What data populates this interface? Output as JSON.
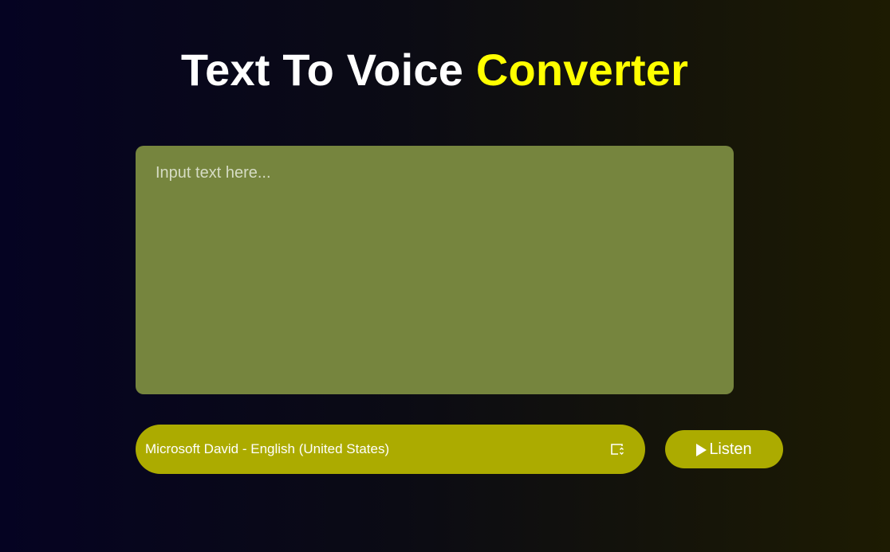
{
  "header": {
    "title_main": "Text To Voice",
    "title_accent": "Converter"
  },
  "input": {
    "placeholder": "Input text here...",
    "value": ""
  },
  "voice_select": {
    "selected": "Microsoft David - English (United States)",
    "icon": "select-arrows-icon"
  },
  "listen_button": {
    "label": "Listen",
    "icon": "play-icon"
  },
  "colors": {
    "accent": "#ffff00",
    "textarea_bg": "#76853e",
    "control_bg": "#acab00"
  }
}
